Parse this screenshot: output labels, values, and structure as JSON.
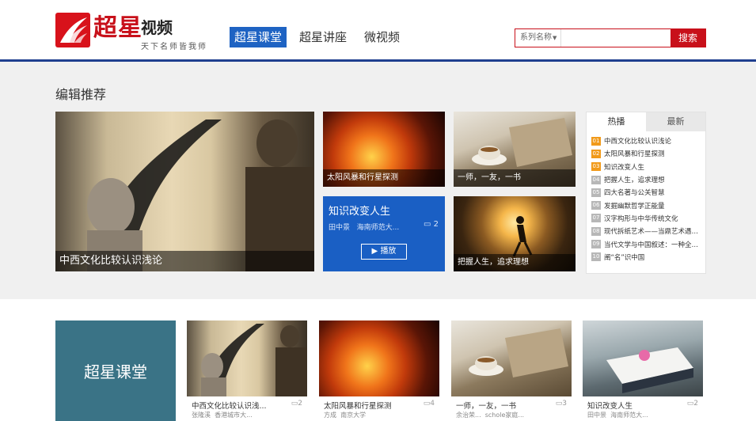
{
  "brand": {
    "logo_text": "超星",
    "video_text": "视频",
    "slogan": "天下名师皆我师"
  },
  "nav": {
    "items": [
      {
        "label": "超星课堂",
        "active": true
      },
      {
        "label": "超星讲座",
        "active": false
      },
      {
        "label": "微视频",
        "active": false
      }
    ]
  },
  "search": {
    "select_label": "系列名称",
    "placeholder": "",
    "button_label": "搜索"
  },
  "editor_picks": {
    "title": "编辑推荐",
    "main": {
      "caption": "中西文化比较认识浅论"
    },
    "tiles": [
      {
        "caption": "太阳风暴和行星探测"
      },
      {
        "caption": "一师，一友，一书"
      },
      {
        "caption": "把握人生，追求理想"
      }
    ],
    "feature": {
      "title": "知识改变人生",
      "author": "田中景",
      "school": "海南师范大...",
      "count": "2",
      "play_label": "播放"
    }
  },
  "ranking": {
    "tabs": [
      {
        "label": "热播",
        "active": true
      },
      {
        "label": "最新",
        "active": false
      }
    ],
    "items": [
      {
        "num": "01",
        "label": "中西文化比较认识浅论",
        "hot": true
      },
      {
        "num": "02",
        "label": "太阳风暴和行星探测",
        "hot": true
      },
      {
        "num": "03",
        "label": "知识改变人生",
        "hot": true
      },
      {
        "num": "04",
        "label": "把握人生，追求理想",
        "hot": false
      },
      {
        "num": "05",
        "label": "四大名著与公关智慧",
        "hot": false
      },
      {
        "num": "06",
        "label": "发掘幽默哲学正能量",
        "hot": false
      },
      {
        "num": "07",
        "label": "汉字构形与中华传统文化",
        "hot": false
      },
      {
        "num": "08",
        "label": "现代拆纸艺术——当鼎艺术遇上...",
        "hot": false
      },
      {
        "num": "09",
        "label": "当代文学与中国叙述：一种全球...",
        "hot": false
      },
      {
        "num": "10",
        "label": "阐“名”识中国",
        "hot": false
      }
    ]
  },
  "course_section": {
    "title": "超星课堂",
    "courses": [
      {
        "title": "中西文化比较认识浅...",
        "count": "2",
        "author": "张隆溪",
        "school": "香港城市大..."
      },
      {
        "title": "太阳风暴和行星探测",
        "count": "4",
        "author": "方成",
        "school": "南京大学"
      },
      {
        "title": "一师，一友，一书",
        "count": "3",
        "author": "余治荣...",
        "school": "schole家庭..."
      },
      {
        "title": "知识改变人生",
        "count": "2",
        "author": "田中景",
        "school": "海南师范大..."
      }
    ]
  }
}
